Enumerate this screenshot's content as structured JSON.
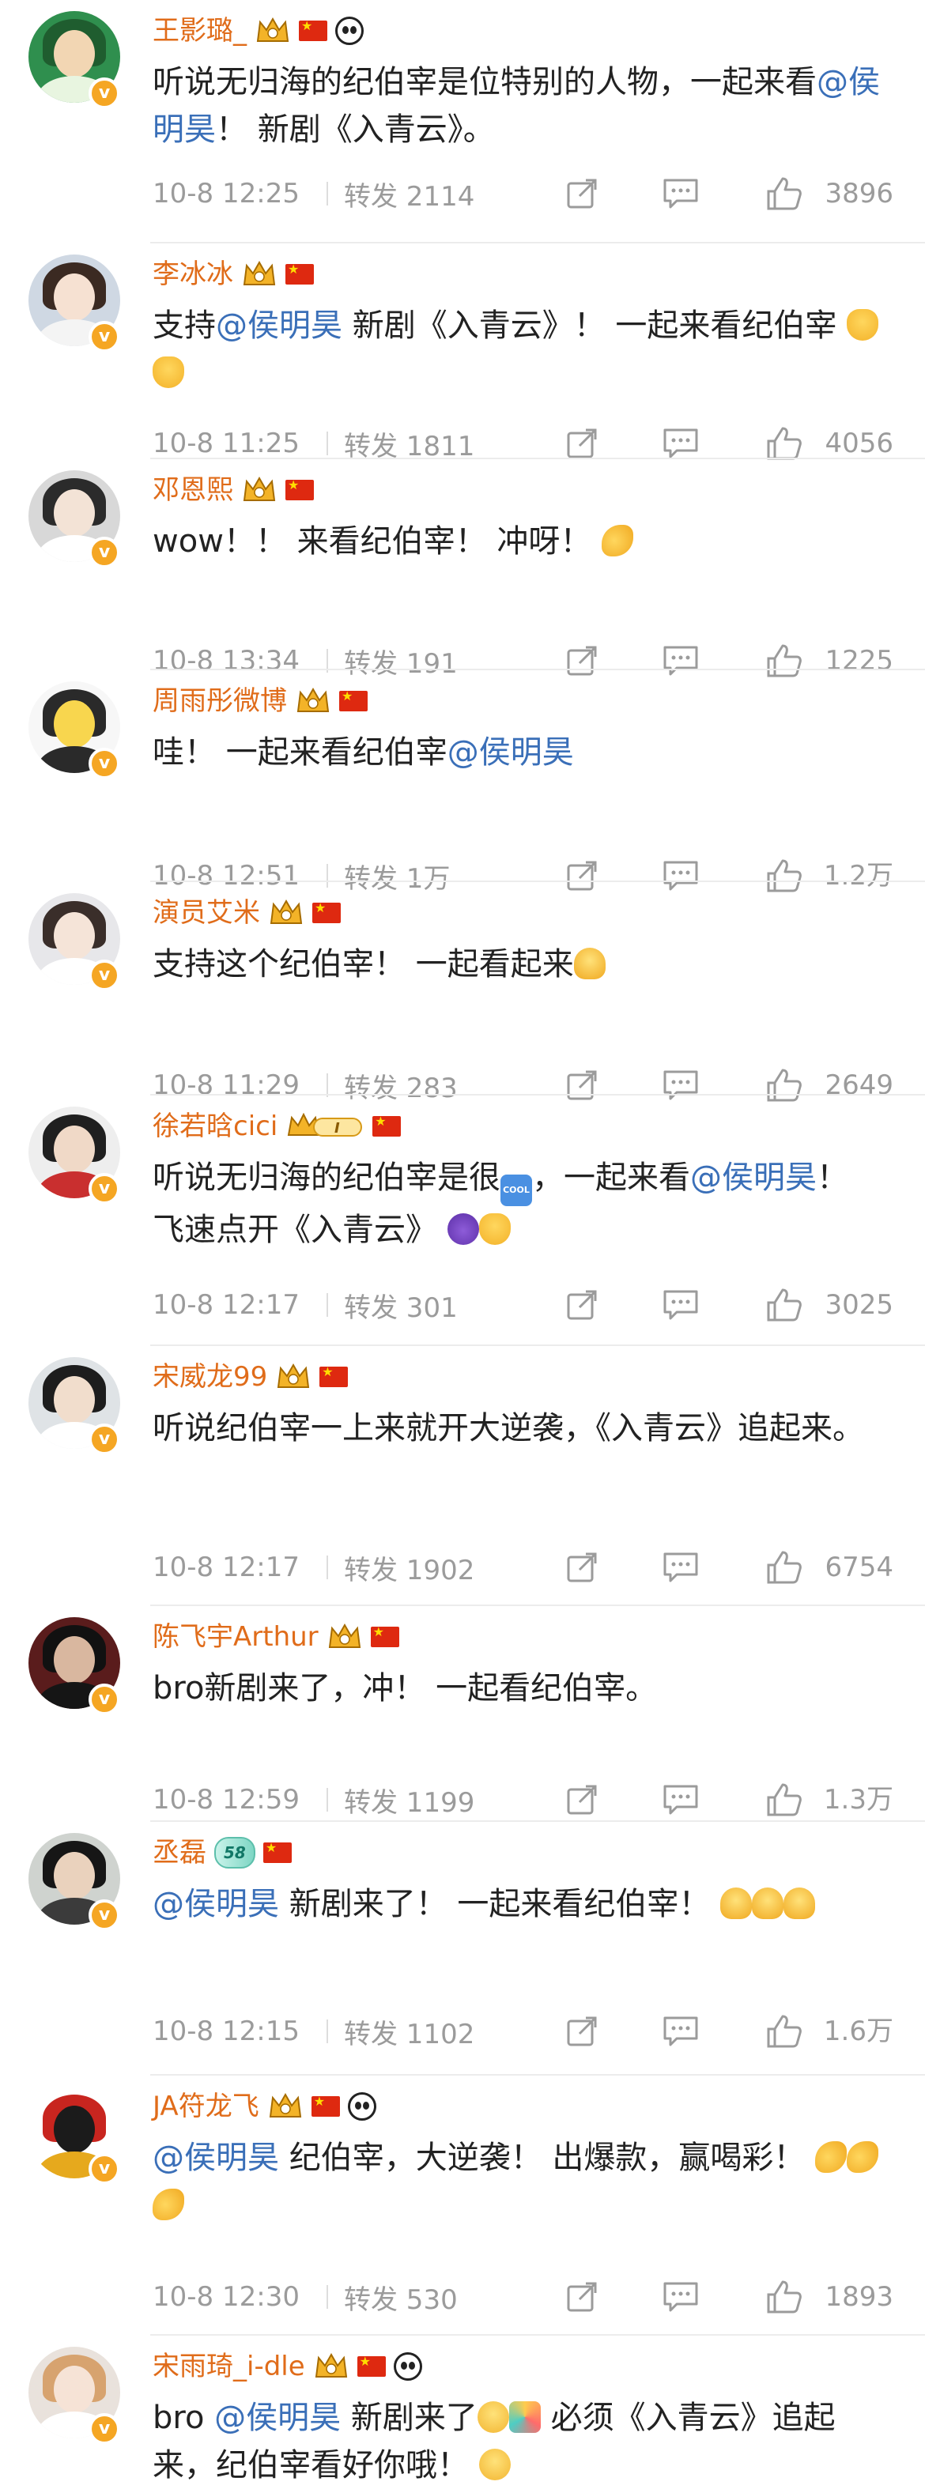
{
  "comments": [
    {
      "name": "王影璐_",
      "badges": [
        "crown",
        "flag",
        "panda"
      ],
      "parts": [
        {
          "t": "听说无归海的纪伯宰是位特别的人物，一起来看"
        },
        {
          "t": "@侯明昊",
          "m": true
        },
        {
          "t": "！ 新剧《入青云》。"
        }
      ],
      "time": "10-8 12:25",
      "repost": "转发 2114",
      "likes": "3896",
      "avatar": {
        "bg": "#2f8f4e",
        "hair": "#1f5d2f",
        "face": "#f2d6b3",
        "body": "#e8f5e0"
      }
    },
    {
      "name": "李冰冰",
      "badges": [
        "crown",
        "flag"
      ],
      "parts": [
        {
          "t": "支持"
        },
        {
          "t": "@侯明昊",
          "m": true
        },
        {
          "t": " 新剧《入青云》！ 一起来看纪伯宰 "
        },
        {
          "e": "e-victory"
        },
        {
          "e": "e-victory"
        }
      ],
      "time": "10-8 11:25",
      "repost": "转发 1811",
      "likes": "4056",
      "avatar": {
        "bg": "#cfd8e3",
        "hair": "#3b2a22",
        "face": "#f6e1d2",
        "body": "#f4f4f4"
      }
    },
    {
      "name": "邓恩熙",
      "badges": [
        "crown",
        "flag"
      ],
      "parts": [
        {
          "t": "wow！！ 来看纪伯宰！ 冲呀！ "
        },
        {
          "e": "e-muscle"
        }
      ],
      "time": "10-8 13:34",
      "repost": "转发 191",
      "likes": "1225",
      "avatar": {
        "bg": "#d8d8d8",
        "hair": "#2b2b2b",
        "face": "#f3e3d6",
        "body": "#ffffff"
      }
    },
    {
      "name": "周雨彤微博",
      "badges": [
        "crown",
        "flag"
      ],
      "parts": [
        {
          "t": "哇！ 一起来看纪伯宰"
        },
        {
          "t": "@侯明昊",
          "m": true
        }
      ],
      "time": "10-8 12:51",
      "repost": "转发 1万",
      "likes": "1.2万",
      "avatar": {
        "bg": "#f7f7f7",
        "hair": "#2a2a2a",
        "face": "#f8d64e",
        "body": "#2a2a2a"
      }
    },
    {
      "name": "演员艾米",
      "badges": [
        "crown",
        "flag"
      ],
      "parts": [
        {
          "t": "支持这个纪伯宰！ 一起看起来"
        },
        {
          "e": "e-thumb"
        }
      ],
      "time": "10-8 11:29",
      "repost": "转发 283",
      "likes": "2649",
      "avatar": {
        "bg": "#e7e7ea",
        "hair": "#3a2e2a",
        "face": "#f5e4d8",
        "body": "#ffffff"
      }
    },
    {
      "name": "徐若晗cici",
      "badges": [
        "crownI",
        "flag"
      ],
      "parts": [
        {
          "t": "听说无归海的纪伯宰是很"
        },
        {
          "e": "e-cool",
          "label": "COOL"
        },
        {
          "t": "，一起来看"
        },
        {
          "t": "@侯明昊",
          "m": true
        },
        {
          "t": "！ 飞速点开《入青云》 "
        },
        {
          "e": "e-devil"
        },
        {
          "e": "e-victory"
        }
      ],
      "time": "10-8 12:17",
      "repost": "转发 301",
      "likes": "3025",
      "avatar": {
        "bg": "#eeeeee",
        "hair": "#1f1f1f",
        "face": "#f0d9c7",
        "body": "#c92f2f"
      }
    },
    {
      "name": "宋威龙99",
      "badges": [
        "crown",
        "flag"
      ],
      "parts": [
        {
          "t": "听说纪伯宰一上来就开大逆袭，《入青云》追起来。"
        }
      ],
      "time": "10-8 12:17",
      "repost": "转发 1902",
      "likes": "6754",
      "avatar": {
        "bg": "#dfe3e6",
        "hair": "#1d1d1d",
        "face": "#f1ddcc",
        "body": "#ffffff"
      }
    },
    {
      "name": "陈飞宇Arthur",
      "badges": [
        "crown",
        "flag"
      ],
      "parts": [
        {
          "t": "bro新剧来了，冲！ 一起看纪伯宰。"
        }
      ],
      "time": "10-8 12:59",
      "repost": "转发 1199",
      "likes": "1.3万",
      "avatar": {
        "bg": "#5a1c1c",
        "hair": "#111111",
        "face": "#d9b79f",
        "body": "#151515"
      }
    },
    {
      "name": "丞磊",
      "badges": [
        "lv58",
        "flag"
      ],
      "level": "58",
      "parts": [
        {
          "t": "@侯明昊",
          "m": true
        },
        {
          "t": " 新剧来了！ 一起来看纪伯宰！ "
        },
        {
          "e": "e-thumb"
        },
        {
          "e": "e-thumb"
        },
        {
          "e": "e-thumb"
        }
      ],
      "time": "10-8 12:15",
      "repost": "转发 1102",
      "likes": "1.6万",
      "avatar": {
        "bg": "#cfd3cf",
        "hair": "#161616",
        "face": "#ead2bd",
        "body": "#3b3b3b"
      }
    },
    {
      "name": "JA符龙飞",
      "badges": [
        "crown",
        "flag",
        "panda"
      ],
      "parts": [
        {
          "t": "@侯明昊",
          "m": true
        },
        {
          "t": " 纪伯宰，大逆袭！ 出爆款，赢喝彩！ "
        },
        {
          "e": "e-muscle"
        },
        {
          "e": "e-muscle"
        },
        {
          "e": "e-muscle"
        }
      ],
      "time": "10-8 12:30",
      "repost": "转发 530",
      "likes": "1893",
      "avatar": {
        "bg": "#ffffff",
        "hair": "#c8251f",
        "face": "#1b1b1b",
        "body": "#e6a91d"
      }
    },
    {
      "name": "宋雨琦_i-dle",
      "badges": [
        "crown",
        "flag",
        "panda"
      ],
      "parts": [
        {
          "t": "bro "
        },
        {
          "t": "@侯明昊",
          "m": true
        },
        {
          "t": " 新剧来了"
        },
        {
          "e": "e-face"
        },
        {
          "e": "e-party"
        },
        {
          "t": " 必须《入青云》追起来，纪伯宰看好你哦！ "
        },
        {
          "e": "e-face"
        }
      ],
      "time": "",
      "repost": "",
      "likes": "",
      "avatar": {
        "bg": "#e9e2dc",
        "hair": "#d7a36f",
        "face": "#f6e3d6",
        "body": "#ffffff"
      }
    }
  ],
  "icons": {
    "verified": "verified-badge-icon",
    "crown": "vip-crown-icon",
    "flag": "china-flag-icon",
    "panda": "panda-icon",
    "share": "share-icon",
    "comment": "comment-icon",
    "like": "thumb-up-icon"
  },
  "colors": {
    "username": "#e06c1a",
    "mention": "#3a6fb8",
    "meta": "#9b9b9b",
    "verified": "#f5a623"
  }
}
